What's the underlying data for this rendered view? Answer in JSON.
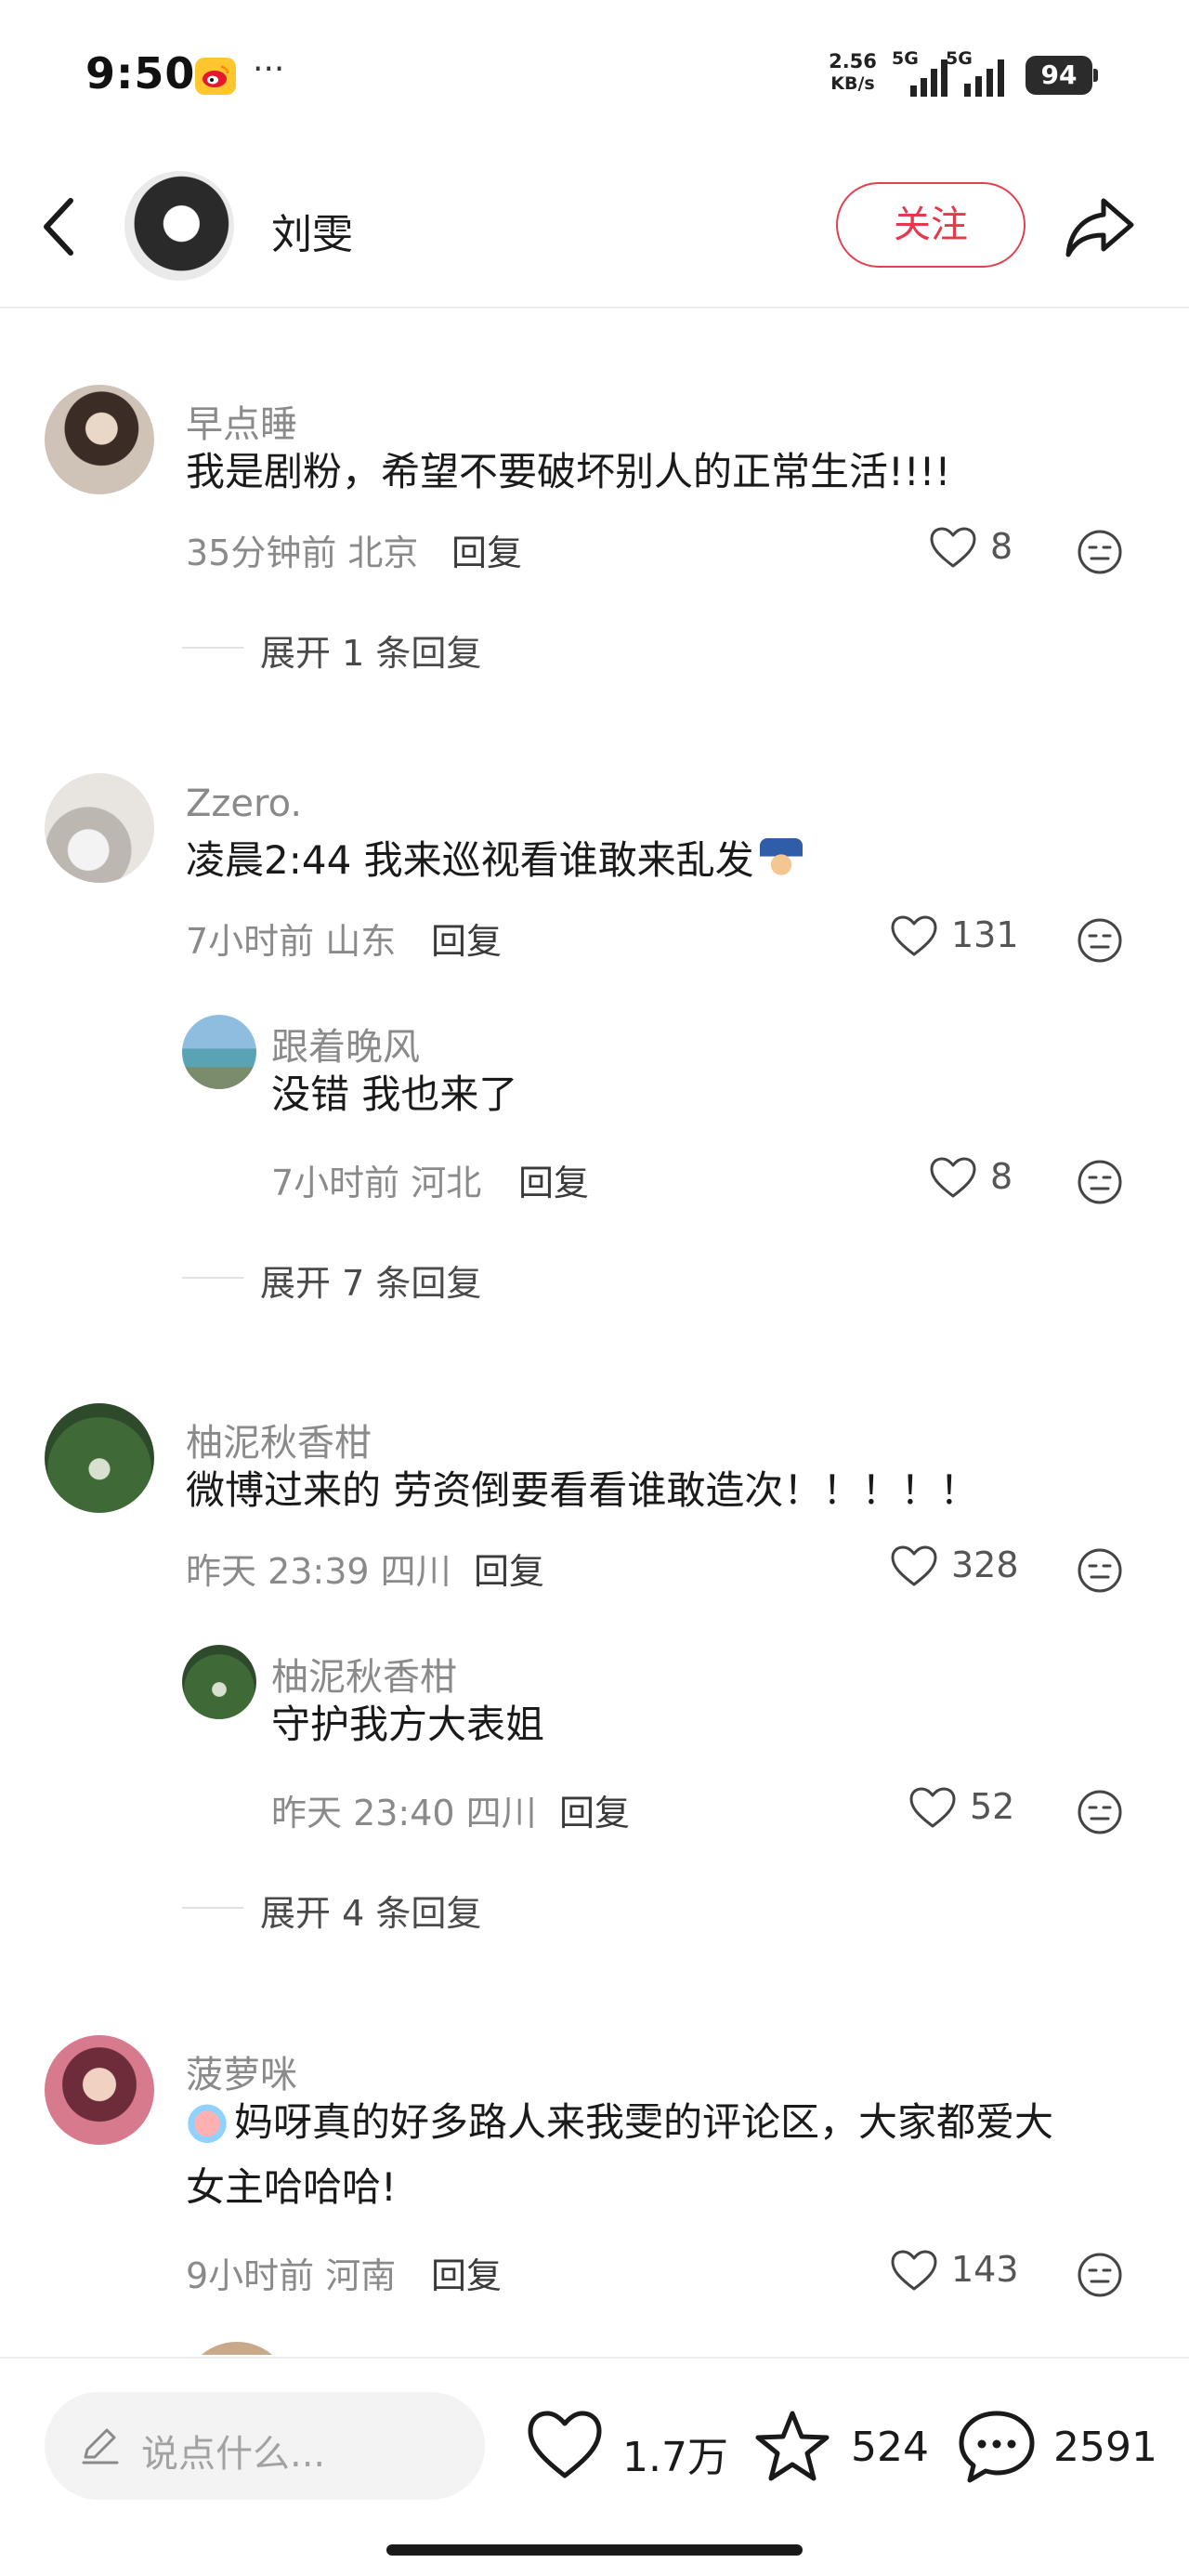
{
  "status_bar": {
    "time": "9:50",
    "dots": "···",
    "net_speed_value": "2.56",
    "net_speed_unit": "KB/s",
    "signal_1_label": "5G",
    "signal_2_label": "5G",
    "battery": "94"
  },
  "header": {
    "name": "刘雯",
    "follow_label": "关注"
  },
  "comments": [
    {
      "user": "早点睡",
      "text": "我是剧粉，希望不要破坏别人的正常生活!!!!",
      "time_location": "35分钟前 北京",
      "reply_label": "回复",
      "likes": "8",
      "expand_label": "展开 1 条回复"
    },
    {
      "user": "Zzero.",
      "text": "凌晨2:44 我来巡视看谁敢来乱发",
      "time_location": "7小时前 山东",
      "reply_label": "回复",
      "likes": "131",
      "reply": {
        "user": "跟着晚风",
        "text": "没错 我也来了",
        "time_location": "7小时前 河北",
        "reply_label": "回复",
        "likes": "8"
      },
      "expand_label": "展开 7 条回复"
    },
    {
      "user": "柚泥秋香柑",
      "text": "微博过来的 劳资倒要看看谁敢造次！！！！！",
      "time_location": "昨天 23:39 四川",
      "reply_label": "回复",
      "likes": "328",
      "reply": {
        "user": "柚泥秋香柑",
        "text": "守护我方大表姐",
        "time_location": "昨天 23:40 四川",
        "reply_label": "回复",
        "likes": "52"
      },
      "expand_label": "展开 4 条回复"
    },
    {
      "user": "菠萝咪",
      "text_line1": "妈呀真的好多路人来我雯的评论区，大家都爱大",
      "text_line2": "女主哈哈哈!",
      "time_location": "9小时前 河南",
      "reply_label": "回复",
      "likes": "143"
    }
  ],
  "bottom_bar": {
    "input_placeholder": "说点什么...",
    "likes": "1.7万",
    "favorites": "524",
    "comments": "2591"
  },
  "icons": {
    "back": "chevron-left-icon",
    "share": "share-arrow-icon",
    "like": "heart-outline-icon",
    "reaction": "neutral-face-icon",
    "pencil": "pencil-icon",
    "favorite": "star-outline-icon",
    "comment": "speech-bubble-icon"
  },
  "colors": {
    "accent": "#e23a4b",
    "text_primary": "#1a1a1a",
    "text_secondary": "#8a8a8a"
  }
}
